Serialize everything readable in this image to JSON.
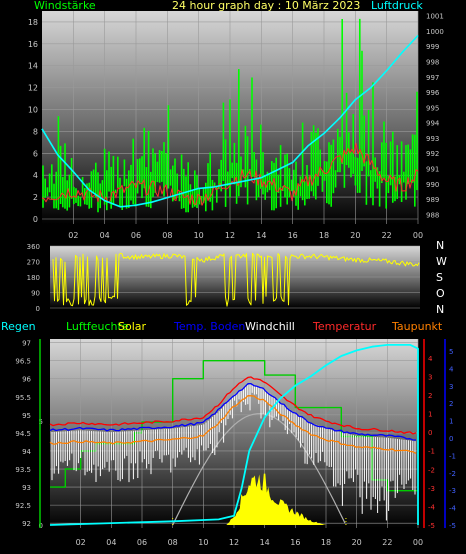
{
  "colors": {
    "wind": "#00ff00",
    "pressure": "#00ffff",
    "gust_trace": "#ff2a2a",
    "direction": "#ffff00",
    "humidity": "#00cc00",
    "solar": "#ffff00",
    "soil_temp": "#0000ff",
    "windchill": "#ffffff",
    "temperature": "#ff0000",
    "dewpoint": "#ff8000",
    "rain": "#00ffff",
    "grid": "#9a9a9a",
    "text": "#c8c8c8"
  },
  "header": {
    "title": "24 hour graph day : 10 März 2023",
    "left_label": "Windstärke",
    "right_label": "Luftdruck"
  },
  "direction_letters": [
    "N",
    "W",
    "S",
    "O",
    "N"
  ],
  "bottom_legend": {
    "rain": "Regen",
    "humidity": "Luftfeuchte",
    "solar": "Solar",
    "soil_temp": "Temp. Boden",
    "windchill": "Windchill",
    "temperature": "Temperatur",
    "dewpoint": "Taupunkt"
  },
  "chart_data": [
    {
      "type": "line",
      "id": "wind_pressure",
      "x_ticks": [
        "02",
        "04",
        "06",
        "08",
        "10",
        "12",
        "14",
        "16",
        "18",
        "20",
        "22",
        "00"
      ],
      "y_left_ticks": [
        "0",
        "2",
        "4",
        "6",
        "8",
        "10",
        "12",
        "14",
        "16",
        "18"
      ],
      "y_left_range": [
        0,
        19
      ],
      "y_right_ticks": [
        "988",
        "989",
        "990",
        "991",
        "992",
        "993",
        "994",
        "995",
        "996",
        "997",
        "998",
        "999",
        "1000",
        "1001"
      ],
      "y_right_range": [
        987.7,
        1001.3
      ],
      "series": [
        {
          "name": "Windstärke",
          "x": [
            0,
            1,
            2,
            3,
            4,
            5,
            6,
            7,
            8,
            9,
            10,
            11,
            12,
            13,
            14,
            15,
            16,
            17,
            18,
            19,
            20,
            21,
            22,
            23,
            24
          ],
          "values": [
            5,
            4,
            3,
            3.5,
            4,
            5,
            6,
            6,
            5,
            4,
            3,
            5,
            6,
            7,
            6,
            5,
            4,
            6,
            7,
            8,
            9,
            8,
            6,
            5,
            7
          ]
        },
        {
          "name": "Luftdruck",
          "x": [
            0,
            1,
            2,
            3,
            4,
            5,
            6,
            7,
            8,
            9,
            10,
            11,
            12,
            13,
            14,
            15,
            16,
            17,
            18,
            19,
            20,
            21,
            22,
            23,
            24
          ],
          "values": [
            993.6,
            991.9,
            990.8,
            989.6,
            988.9,
            988.5,
            988.6,
            988.8,
            989.1,
            989.4,
            989.7,
            989.8,
            990.0,
            990.2,
            990.4,
            990.9,
            991.4,
            992.5,
            993.3,
            994.3,
            995.5,
            996.3,
            997.4,
            998.6,
            999.7
          ]
        },
        {
          "name": "Böen",
          "x": [
            0,
            1,
            2,
            3,
            4,
            5,
            6,
            7,
            8,
            9,
            10,
            11,
            12,
            13,
            14,
            15,
            16,
            17,
            18,
            19,
            20,
            21,
            22,
            23,
            24
          ],
          "values": [
            2,
            2.3,
            2.6,
            2.2,
            2.0,
            2.5,
            3.0,
            2.8,
            2.5,
            2.0,
            1.8,
            2.5,
            3.5,
            4.0,
            3.6,
            3.0,
            2.2,
            3.5,
            4.5,
            5.5,
            6.5,
            5.0,
            3.5,
            3.0,
            4.0
          ]
        }
      ]
    },
    {
      "type": "scatter",
      "id": "wind_direction",
      "y_ticks": [
        "0",
        "90",
        "180",
        "270",
        "360"
      ],
      "y_range": [
        0,
        360
      ],
      "series": [
        {
          "name": "Windrichtung",
          "x": [
            0,
            1,
            2,
            3,
            4,
            5,
            6,
            7,
            8,
            9,
            10,
            11,
            12,
            13,
            14,
            15,
            16,
            17,
            18,
            19,
            20,
            21,
            22,
            23,
            24
          ],
          "values": [
            300,
            280,
            300,
            290,
            310,
            300,
            295,
            300,
            305,
            290,
            280,
            300,
            300,
            305,
            310,
            300,
            300,
            300,
            295,
            285,
            280,
            275,
            270,
            260,
            250
          ]
        }
      ]
    },
    {
      "type": "line",
      "id": "humidity_temperature",
      "y_left_ticks": [
        "92",
        "92.5",
        "93",
        "93.5",
        "94",
        "94.5",
        "95",
        "95.5",
        "96",
        "96.5",
        "97"
      ],
      "y_left_range": [
        91.95,
        97.1
      ],
      "y_mid_ticks": [
        "0",
        "5"
      ],
      "y_right1_ticks": [
        "-5",
        "-4",
        "-3",
        "-2",
        "-1",
        "0",
        "1",
        "2",
        "3",
        "4"
      ],
      "y_right2_ticks": [
        "-5",
        "-4",
        "-3",
        "-2",
        "-1",
        "0",
        "1",
        "2",
        "3",
        "4",
        "5"
      ],
      "temp_range": [
        -5,
        4.8
      ],
      "series": [
        {
          "name": "Luftfeuchte",
          "x": [
            0,
            1,
            1,
            2,
            2,
            3,
            3,
            5.5,
            5.5,
            6,
            6,
            8,
            8,
            10,
            10,
            14,
            14,
            16,
            16,
            19,
            19,
            21,
            21,
            22,
            22,
            24
          ],
          "values": [
            93,
            93,
            93.5,
            93.5,
            94,
            94,
            94.2,
            94.2,
            94.5,
            94.5,
            94.8,
            94.8,
            96,
            96,
            96.5,
            96.5,
            96.1,
            96.1,
            95.2,
            95.2,
            94.4,
            94.4,
            93.2,
            93.2,
            92.9,
            92.9
          ]
        },
        {
          "name": "Temperatur",
          "x": [
            0,
            2,
            4,
            6,
            8,
            10,
            11,
            12,
            13,
            14,
            15,
            16,
            17,
            18,
            20,
            22,
            24
          ],
          "values": [
            0.4,
            0.5,
            0.4,
            0.5,
            0.6,
            0.8,
            1.5,
            2.4,
            3.0,
            2.7,
            2.0,
            1.4,
            0.9,
            0.6,
            0.2,
            0.1,
            -0.1
          ]
        },
        {
          "name": "Taupunkt",
          "x": [
            0,
            2,
            4,
            6,
            8,
            10,
            11,
            12,
            13,
            14,
            15,
            16,
            17,
            18,
            20,
            22,
            24
          ],
          "values": [
            -0.6,
            -0.5,
            -0.6,
            -0.5,
            -0.4,
            -0.2,
            0.5,
            1.4,
            2.0,
            1.7,
            1.0,
            0.4,
            -0.1,
            -0.4,
            -0.8,
            -0.9,
            -1.1
          ]
        },
        {
          "name": "Temp. Boden",
          "x": [
            0,
            2,
            4,
            6,
            8,
            10,
            11,
            12,
            13,
            14,
            15,
            16,
            17,
            18,
            20,
            22,
            24
          ],
          "values": [
            0.1,
            0.2,
            0.1,
            0.2,
            0.3,
            0.5,
            1.2,
            2.0,
            2.6,
            2.3,
            1.6,
            1.0,
            0.5,
            0.2,
            -0.1,
            -0.2,
            -0.4
          ]
        },
        {
          "name": "Windchill",
          "x": [
            0,
            2,
            4,
            6,
            8,
            10,
            11,
            12,
            13,
            14,
            15,
            16,
            17,
            18,
            20,
            22,
            24
          ],
          "values": [
            -1.2,
            -1.0,
            -1.5,
            -1.0,
            -0.8,
            -0.5,
            0.5,
            1.8,
            2.4,
            2.0,
            1.2,
            0.3,
            -0.5,
            -1.0,
            -1.8,
            -2.0,
            -2.2
          ]
        },
        {
          "name": "Regen",
          "x": [
            0,
            8,
            11,
            12,
            12.5,
            13,
            14,
            15,
            16,
            17,
            18,
            19,
            20,
            21,
            22,
            23.5,
            24,
            24
          ],
          "values": [
            -5,
            -4.8,
            -4.7,
            -4.5,
            -3,
            -1,
            0.8,
            1.8,
            2.5,
            3.0,
            3.6,
            4.1,
            4.4,
            4.6,
            4.7,
            4.7,
            4.5,
            -5
          ]
        },
        {
          "name": "Solar",
          "x": [
            11.5,
            12,
            12.5,
            13,
            13.5,
            14,
            14.5,
            15,
            16,
            17,
            18
          ],
          "values": [
            0,
            2,
            6,
            10,
            11,
            10,
            7,
            5,
            3,
            1,
            0
          ]
        }
      ]
    }
  ]
}
